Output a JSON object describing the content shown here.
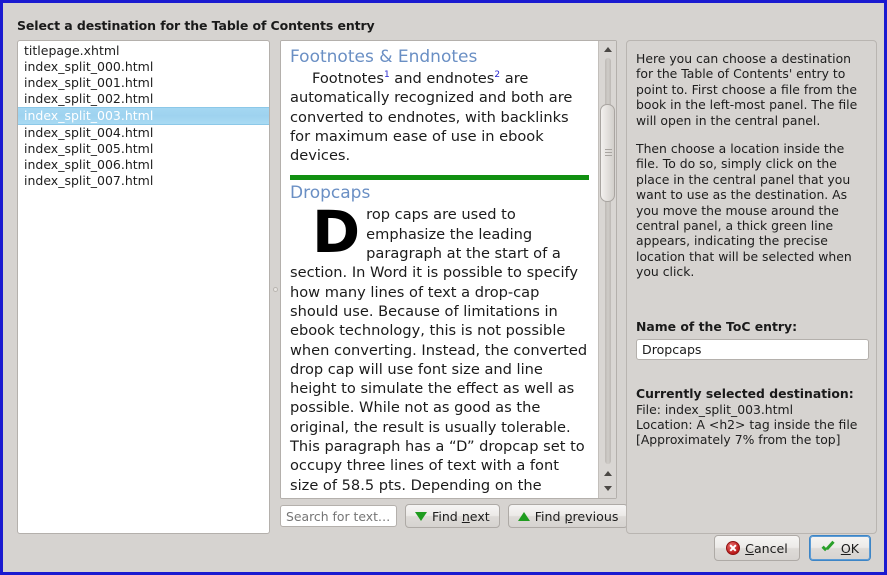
{
  "dialog": {
    "title": "Select a destination for the Table of Contents entry"
  },
  "file_list": {
    "items": [
      {
        "name": "titlepage.xhtml",
        "selected": false
      },
      {
        "name": "index_split_000.html",
        "selected": false
      },
      {
        "name": "index_split_001.html",
        "selected": false
      },
      {
        "name": "index_split_002.html",
        "selected": false
      },
      {
        "name": "index_split_003.html",
        "selected": true
      },
      {
        "name": "index_split_004.html",
        "selected": false
      },
      {
        "name": "index_split_005.html",
        "selected": false
      },
      {
        "name": "index_split_006.html",
        "selected": false
      },
      {
        "name": "index_split_007.html",
        "selected": false
      }
    ]
  },
  "preview": {
    "heading_footnotes": "Footnotes & Endnotes",
    "para_footnotes_a": "Footnotes",
    "fnref_1": "1",
    "para_footnotes_b": " and endnotes",
    "fnref_2": "2",
    "para_footnotes_c": " are automatically recognized and both are converted to endnotes, with backlinks for maximum ease of use in ebook devices.",
    "heading_dropcaps": "Dropcaps",
    "dropcap_letter": "D",
    "para_dropcaps": "rop caps are used to emphasize the leading paragraph at the start of a section. In Word it is possible to specify how many lines of text a drop-cap should use. Because of limitations in ebook technology, this is not possible when converting. Instead, the converted drop cap will use font size and line height to simulate the effect as well as possible. While not as good as the original, the result is usually tolerable. This paragraph has a “D” dropcap set to occupy three lines of text with a font size of 58.5 pts. Depending on the screen width and capabilities of the device you view the book on, this dropcap may look a bit"
  },
  "find_bar": {
    "search_placeholder": "Search for text…",
    "search_value": "",
    "find_next_a": "Find ",
    "find_next_mn": "n",
    "find_next_b": "ext",
    "find_prev_a": "Find ",
    "find_prev_mn": "p",
    "find_prev_b": "revious"
  },
  "help": {
    "paragraph_1": "Here you can choose a destination for the Table of Contents' entry to point to. First choose a file from the book in the left-most panel. The file will open in the central panel.",
    "paragraph_2": "Then choose a location inside the file. To do so, simply click on the place in the central panel that you want to use as the destination. As you move the mouse around the central panel, a thick green line appears, indicating the precise location that will be selected when you click.",
    "toc_name_label": "Name of the ToC entry:",
    "toc_name_value": "Dropcaps",
    "destination_heading": "Currently selected destination:",
    "destination_file": "File: index_split_003.html",
    "destination_location": "Location: A <h2> tag inside the file",
    "destination_approx": "[Approximately 7% from the top]"
  },
  "actions": {
    "cancel_a": "",
    "cancel_mn": "C",
    "cancel_b": "ancel",
    "ok_mn": "O",
    "ok_b": "K"
  },
  "colors": {
    "accent_blue": "#1a1ad0",
    "selection_blue": "#a4d7f2",
    "heading_blue": "#6a8fc4",
    "green_rule": "#119011",
    "green_icon": "#1f9c1f",
    "window_bg": "#d6d3d0"
  }
}
